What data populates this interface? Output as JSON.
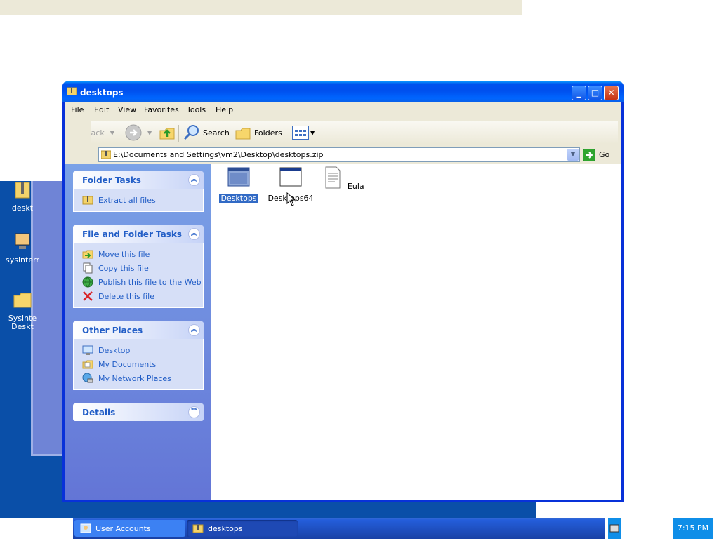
{
  "window": {
    "title": "desktops",
    "minimize_label": "_",
    "maximize_label": "□",
    "close_label": "✕"
  },
  "menu": [
    "File",
    "Edit",
    "View",
    "Favorites",
    "Tools",
    "Help"
  ],
  "toolbar": {
    "back": "Back",
    "search": "Search",
    "folders": "Folders"
  },
  "address": {
    "value": "E:\\Documents and Settings\\vm2\\Desktop\\desktops.zip",
    "go": "Go"
  },
  "task_pane": {
    "folder_tasks": {
      "title": "Folder Tasks",
      "items": [
        "Extract all files"
      ]
    },
    "file_folder_tasks": {
      "title": "File and Folder Tasks",
      "items": [
        "Move this file",
        "Copy this file",
        "Publish this file to the Web",
        "Delete this file"
      ]
    },
    "other_places": {
      "title": "Other Places",
      "items": [
        "Desktop",
        "My Documents",
        "My Network Places"
      ]
    },
    "details": {
      "title": "Details"
    }
  },
  "files": [
    {
      "name": "Desktops",
      "selected": true,
      "icon": "application-window-icon"
    },
    {
      "name": "Desktops64",
      "selected": false,
      "icon": "application-window-icon"
    },
    {
      "name": "Eula",
      "selected": false,
      "icon": "text-document-icon"
    }
  ],
  "desktop_icons": [
    "deskt",
    "sysinterr",
    "Sysinte Deskt"
  ],
  "taskbar": {
    "buttons": [
      "User Accounts",
      "desktops"
    ],
    "clock": "7:15 PM"
  },
  "colors": {
    "title_blue": "#0053ee",
    "task_link": "#215dc6",
    "selection": "#316ac5"
  }
}
